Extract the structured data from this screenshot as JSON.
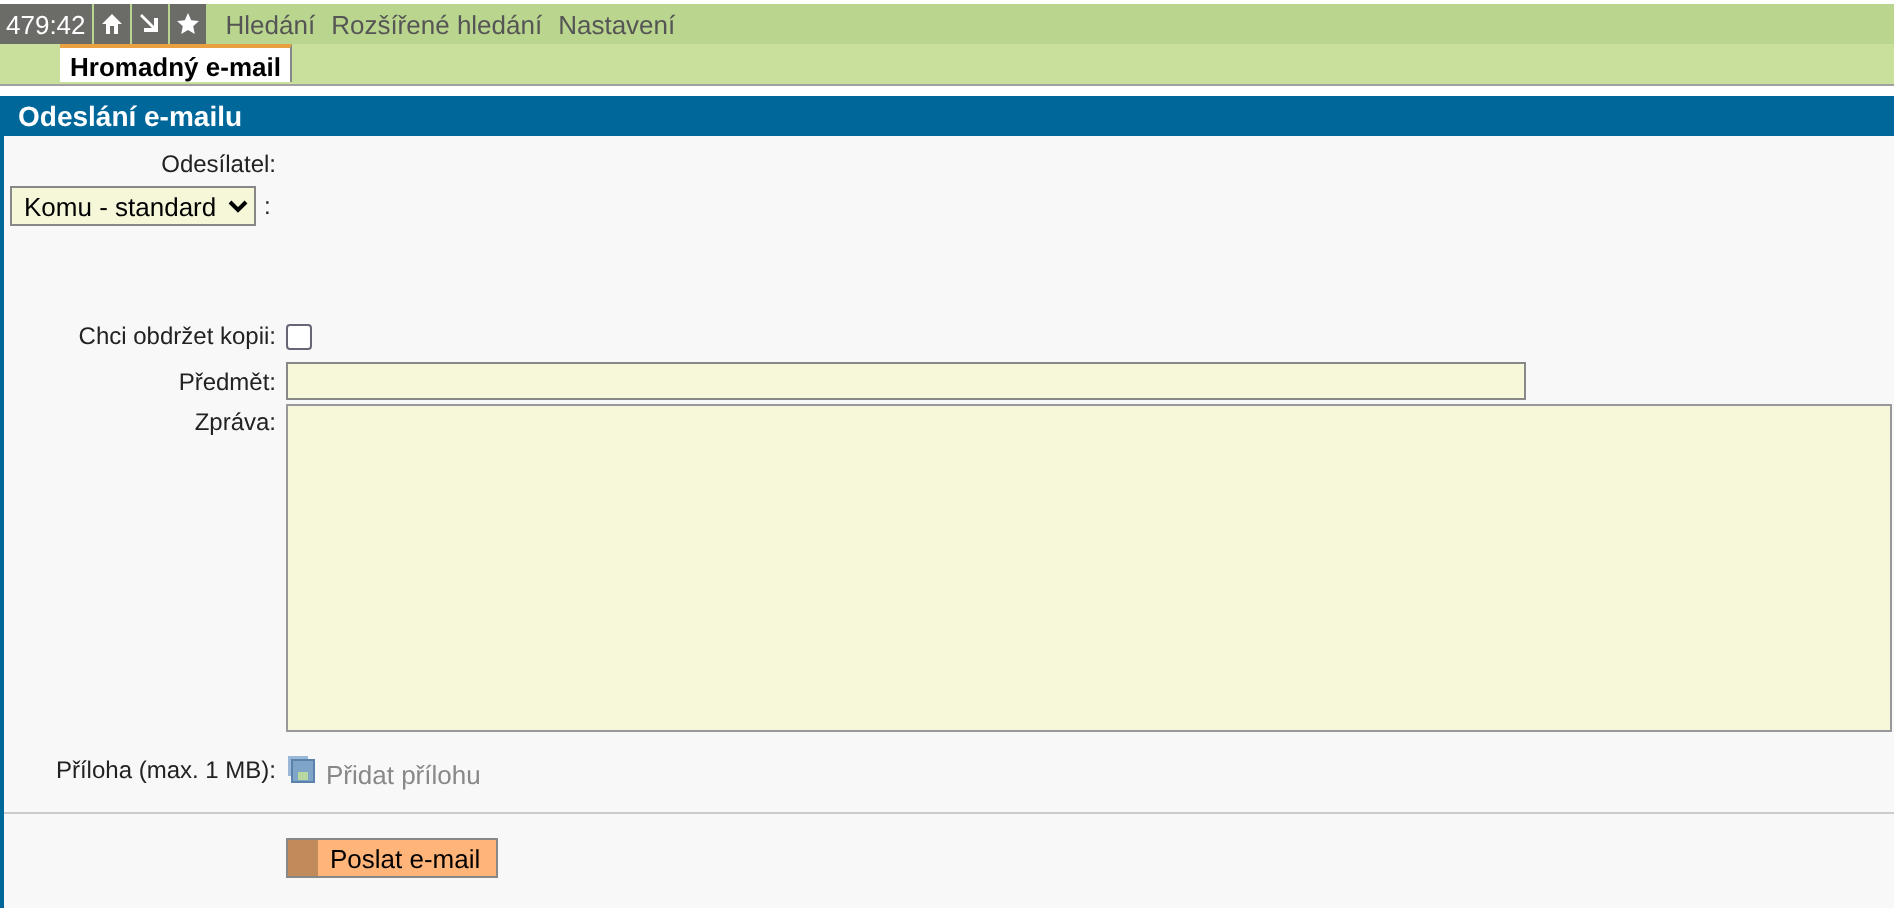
{
  "top_bar": {
    "counter": "479:42",
    "menu": [
      "Hledání",
      "Rozšířené hledání",
      "Nastavení"
    ]
  },
  "tabs": [
    {
      "label": "Hromadný e-mail",
      "selected": true
    }
  ],
  "panel": {
    "title": "Odeslání e-mailu",
    "sender_label": "Odesílatel:",
    "recipient_select": {
      "value": "Komu - standard",
      "suffix": ":"
    },
    "copy": {
      "label": "Chci obdržet kopii:",
      "checked": false
    },
    "subject_label": "Předmět:",
    "message_label": "Zpráva:",
    "attachment_label": "Příloha (max. 1 MB):",
    "attachment_link": "Přidat přílohu",
    "send_button": "Poslat e-mail"
  }
}
